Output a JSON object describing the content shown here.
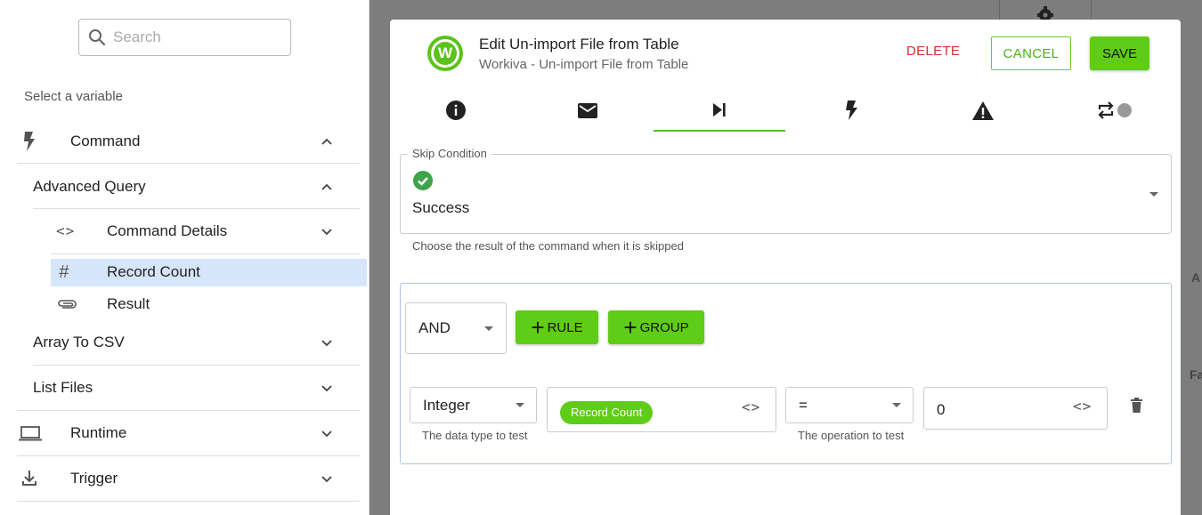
{
  "sidebar": {
    "search_placeholder": "Search",
    "select_label": "Select a variable",
    "command": "Command",
    "advanced_query": "Advanced Query",
    "command_details": "Command Details",
    "record_count": "Record Count",
    "result": "Result",
    "array_to_csv": "Array To CSV",
    "list_files": "List Files",
    "runtime": "Runtime",
    "trigger": "Trigger"
  },
  "background": {
    "label_a": "A",
    "label_f": "Fa"
  },
  "modal": {
    "title": "Edit Un-import File from Table",
    "subtitle": "Workiva - Un-import File from Table",
    "logo_letter": "W",
    "delete_label": "DELETE",
    "cancel_label": "CANCEL",
    "save_label": "SAVE",
    "tabs": [
      "info-icon",
      "mail-icon",
      "skip-next-icon",
      "bolt-icon",
      "warning-icon",
      "repeat-toggle-icon"
    ],
    "active_tab": 2,
    "skip_condition": {
      "legend": "Skip Condition",
      "value": "Success",
      "helper": "Choose the result of the command when it is skipped"
    },
    "rules": {
      "combinator": "AND",
      "add_rule_label": "RULE",
      "add_group_label": "GROUP",
      "rule": {
        "data_type": "Integer",
        "data_type_helper": "The data type to test",
        "variable": "Record Count",
        "operator": "=",
        "operator_helper": "The operation to test",
        "value": "0"
      }
    }
  },
  "colors": {
    "accent_green": "#5fcc17",
    "delete_red": "#d32f2f",
    "selection_blue": "#d5e6fb"
  }
}
